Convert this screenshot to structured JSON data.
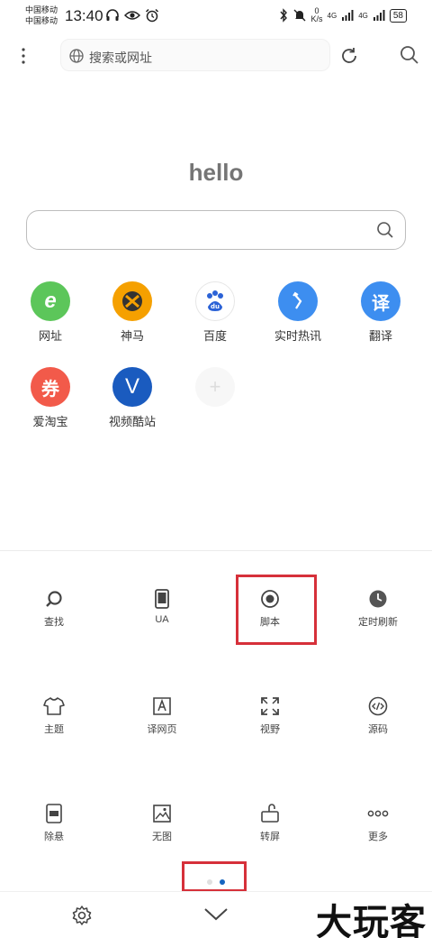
{
  "status": {
    "carrier1": "中国移动",
    "carrier2": "中国移动",
    "time": "13:40",
    "net_speed": "0",
    "net_unit": "K/s",
    "signal1": "4G",
    "signal2": "4G",
    "battery": "58"
  },
  "toolbar": {
    "url_placeholder": "搜索或网址"
  },
  "home": {
    "title": "hello"
  },
  "shortcuts": [
    {
      "label": "网址",
      "glyph": "e",
      "color": "#5cc65a"
    },
    {
      "label": "神马",
      "glyph": "",
      "color": "#f5a000"
    },
    {
      "label": "百度",
      "glyph": "du",
      "color": "#ffffff"
    },
    {
      "label": "实时热讯",
      "glyph": "",
      "color": "#3d8ef0"
    },
    {
      "label": "翻译",
      "glyph": "译",
      "color": "#3d8ef0"
    },
    {
      "label": "爱淘宝",
      "glyph": "券",
      "color": "#f25a4a"
    },
    {
      "label": "视频酷站",
      "glyph": "V",
      "color": "#1a5bbf"
    }
  ],
  "tools": [
    {
      "label": "查找",
      "icon": "search-icon"
    },
    {
      "label": "UA",
      "icon": "phone-icon"
    },
    {
      "label": "脚本",
      "icon": "record-icon"
    },
    {
      "label": "定时刷新",
      "icon": "clock-icon"
    },
    {
      "label": "主题",
      "icon": "shirt-icon"
    },
    {
      "label": "译网页",
      "icon": "translate-page-icon"
    },
    {
      "label": "视野",
      "icon": "expand-icon"
    },
    {
      "label": "源码",
      "icon": "code-icon"
    },
    {
      "label": "除悬",
      "icon": "float-remove-icon"
    },
    {
      "label": "无图",
      "icon": "no-image-icon"
    },
    {
      "label": "转屏",
      "icon": "rotate-screen-icon"
    },
    {
      "label": "更多",
      "icon": "more-icon"
    }
  ],
  "watermark": "大玩客",
  "colors": {
    "highlight": "#d6303a",
    "accent": "#1565c0"
  }
}
